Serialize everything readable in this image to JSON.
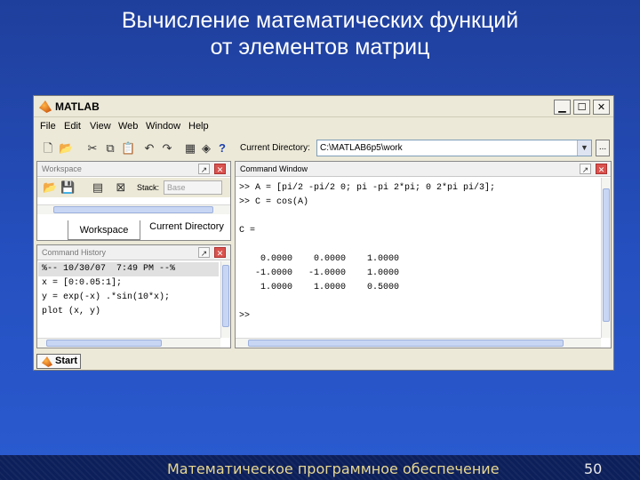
{
  "slide": {
    "title_line1": "Вычисление математических функций",
    "title_line2": "от элементов матриц",
    "footer": "Математическое программное обеспечение",
    "page_number": "50"
  },
  "window": {
    "title": "MATLAB",
    "buttons": {
      "minimize": "▁",
      "maximize": "☐",
      "close": "✕"
    }
  },
  "menu": [
    "File",
    "Edit",
    "View",
    "Web",
    "Window",
    "Help"
  ],
  "toolbar": {
    "current_directory_label": "Current Directory:",
    "current_directory_value": "C:\\MATLAB6p5\\work",
    "browse_label": "...",
    "help_glyph": "?"
  },
  "workspace": {
    "title": "Workspace",
    "stack_label": "Stack:",
    "stack_value": "Base",
    "tabs": [
      "Workspace",
      "Current Directory"
    ]
  },
  "history": {
    "title": "Command History",
    "lines": [
      "%-- 10/30/07  7:49 PM --%",
      "x = [0:0.05:1];",
      "y = exp(-x) .*sin(10*x);",
      "plot (x, y)"
    ]
  },
  "command_window": {
    "title": "Command Window",
    "lines": [
      ">> A = [pi/2 -pi/2 0; pi -pi 2*pi; 0 2*pi pi/3];",
      ">> C = cos(A)",
      "",
      "C =",
      "",
      "    0.0000    0.0000    1.0000",
      "   -1.0000   -1.0000    1.0000",
      "    1.0000    1.0000    0.5000",
      "",
      ">>"
    ]
  },
  "status": {
    "start_label": "Start"
  },
  "colors": {
    "slide_bg": "#2550c0",
    "footer_bg": "#0d1f5a",
    "footer_text": "#e8d890",
    "window_bg": "#ece9d8",
    "history_highlight": "#e0e0e0"
  }
}
